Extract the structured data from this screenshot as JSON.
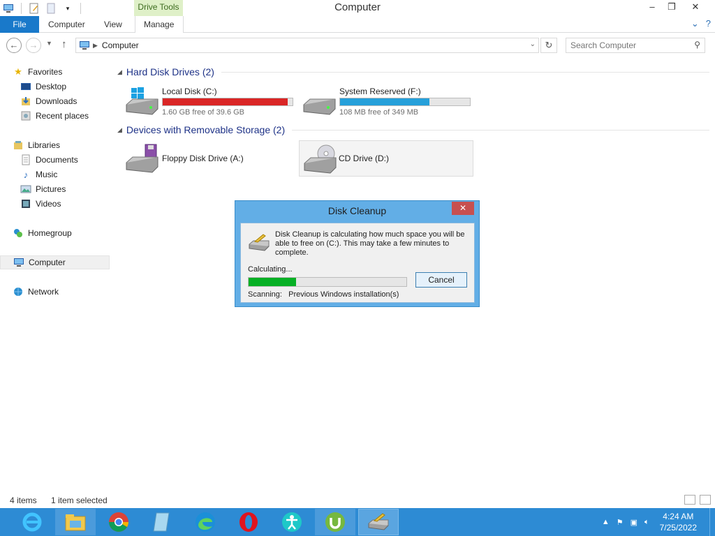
{
  "window": {
    "title": "Computer",
    "contextual_tab_group": "Drive Tools",
    "minimize": "–",
    "restore": "❐",
    "close": "✕"
  },
  "ribbon": {
    "tabs": [
      "File",
      "Computer",
      "View",
      "Manage"
    ],
    "expand_glyph": "⌄",
    "help_glyph": "?"
  },
  "address": {
    "path": "Computer",
    "search_placeholder": "Search Computer"
  },
  "nav": {
    "favorites": "Favorites",
    "desktop": "Desktop",
    "downloads": "Downloads",
    "recent_places": "Recent places",
    "libraries": "Libraries",
    "documents": "Documents",
    "music": "Music",
    "pictures": "Pictures",
    "videos": "Videos",
    "homegroup": "Homegroup",
    "computer": "Computer",
    "network": "Network"
  },
  "content": {
    "hdd_header": "Hard Disk Drives (2)",
    "removable_header": "Devices with Removable Storage (2)",
    "drives": [
      {
        "name": "Local Disk (C:)",
        "free": "1.60 GB free of 39.6 GB",
        "used_fraction": 0.96,
        "bar_color": "#da2626"
      },
      {
        "name": "System Reserved (F:)",
        "free": "108 MB free of 349 MB",
        "used_fraction": 0.69,
        "bar_color": "#26a0da"
      }
    ],
    "removable": [
      {
        "name": "Floppy Disk Drive (A:)"
      },
      {
        "name": "CD Drive (D:)"
      }
    ]
  },
  "status": {
    "items": "4 items",
    "selected": "1 item selected"
  },
  "dialog": {
    "title": "Disk Cleanup",
    "message": "Disk Cleanup is calculating how much space you will be able to free on  (C:). This may take a few minutes to complete.",
    "calculating": "Calculating...",
    "progress_fraction": 0.3,
    "cancel": "Cancel",
    "scanning_label": "Scanning:",
    "scanning_item": "Previous Windows installation(s)",
    "close": "✕"
  },
  "taskbar": {
    "apps": [
      "ie-icon",
      "file-explorer-icon",
      "chrome-icon",
      "notepad-icon",
      "edge-icon",
      "opera-icon",
      "accessibility-icon",
      "utorrent-icon",
      "disk-cleanup-icon"
    ],
    "time": "4:24 AM",
    "date": "7/25/2022",
    "tray_arrow": "▲"
  },
  "colors": {
    "file_tab": "#1979ca",
    "taskbar": "#2d8bd4",
    "dialog_frame": "#62aee6",
    "progress": "#06b025"
  }
}
